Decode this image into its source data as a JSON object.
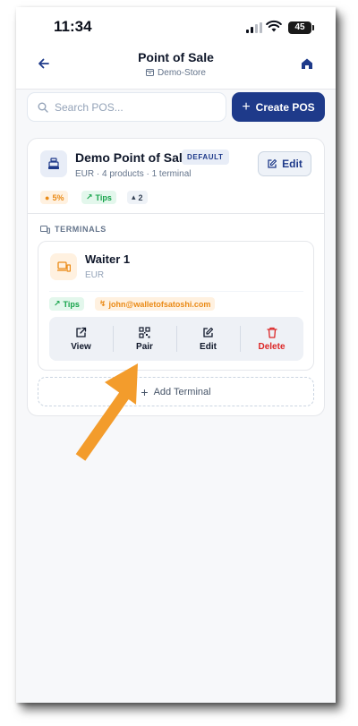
{
  "status_bar": {
    "time": "11:34",
    "battery": "45"
  },
  "header": {
    "title": "Point of Sale",
    "store": "Demo-Store"
  },
  "toolbar": {
    "search_placeholder": "Search POS...",
    "create_label": "Create POS"
  },
  "pos": {
    "name": "Demo Point of Sale",
    "badge": "DEFAULT",
    "meta": "EUR · 4 products · 1 terminal",
    "edit_label": "Edit",
    "chips": {
      "fee": "5%",
      "tips": "Tips",
      "count": "2"
    }
  },
  "terminals": {
    "heading": "TERMINALS",
    "items": [
      {
        "name": "Waiter 1",
        "currency": "EUR",
        "tips": "Tips",
        "address": "john@walletofsatoshi.com",
        "actions": {
          "view": "View",
          "pair": "Pair",
          "edit": "Edit",
          "delete": "Delete"
        }
      }
    ],
    "add_label": "Add Terminal"
  },
  "colors": {
    "primary": "#1e3a8a",
    "accent_orange": "#f39c2c",
    "danger": "#dc2626",
    "success": "#16a34a"
  },
  "annotation": {
    "type": "arrow",
    "points_to": "pair-button",
    "color": "#f39c2c"
  }
}
